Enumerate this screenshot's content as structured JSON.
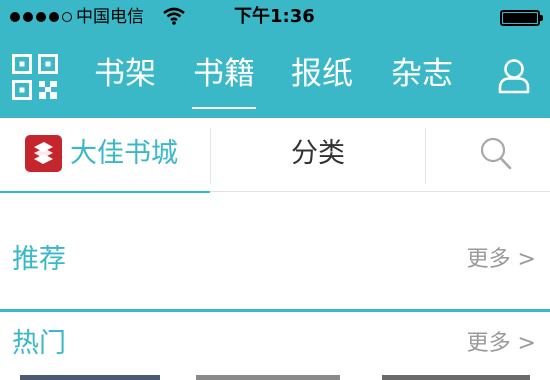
{
  "status_bar": {
    "carrier": "中国电信",
    "time": "下午1:36",
    "signal_bars_filled": 4,
    "signal_bars_total": 5
  },
  "nav": {
    "tabs": [
      {
        "label": "书架",
        "active": false
      },
      {
        "label": "书籍",
        "active": true
      },
      {
        "label": "报纸",
        "active": false
      },
      {
        "label": "杂志",
        "active": false
      }
    ],
    "left_icon": "qr-code-icon",
    "right_icon": "user-icon"
  },
  "subtabs": {
    "store_label": "大佳书城",
    "category_label": "分类",
    "search_icon": "search-icon",
    "active": "store"
  },
  "sections": {
    "recommend": {
      "title": "推荐",
      "more": "更多 >"
    },
    "hot": {
      "title": "热门",
      "more": "更多 >"
    }
  },
  "colors": {
    "accent": "#3ab8c7",
    "logo_red": "#c5262d",
    "muted_text": "#9a9a9a"
  }
}
